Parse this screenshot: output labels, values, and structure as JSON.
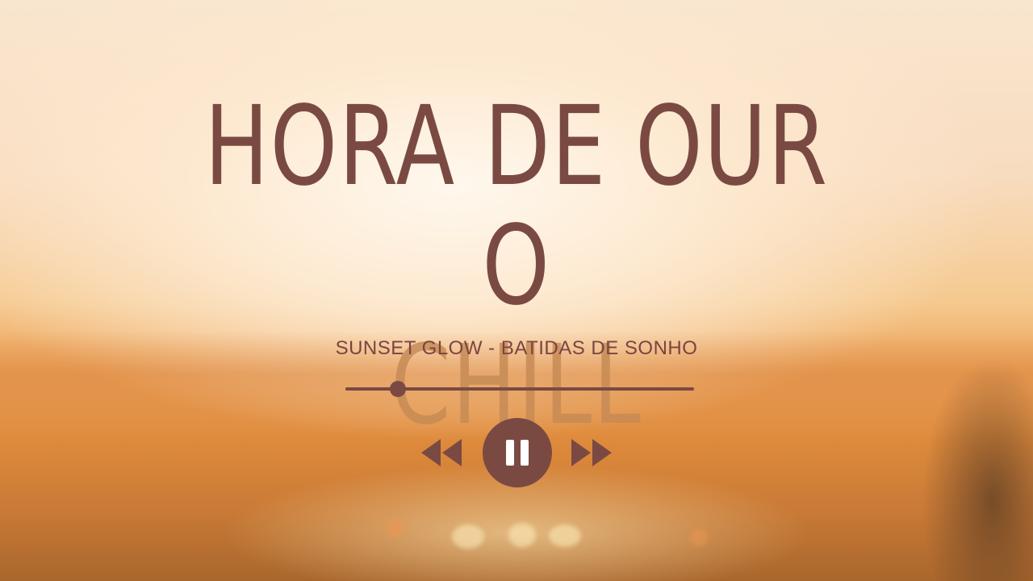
{
  "player": {
    "title_lines": [
      "HORA DE OUR",
      "O",
      "CHILL"
    ],
    "subtitle": "SUNSET GLOW - BATIDAS DE SONHO",
    "progress_fraction": 0.15,
    "state": "playing",
    "controls": {
      "previous_icon": "rewind-icon",
      "pause_icon": "pause-icon",
      "next_icon": "fast-forward-icon"
    },
    "colors": {
      "text": "#7a4a42",
      "title_faded": "#c58a55",
      "accent": "#7a4a42"
    }
  }
}
